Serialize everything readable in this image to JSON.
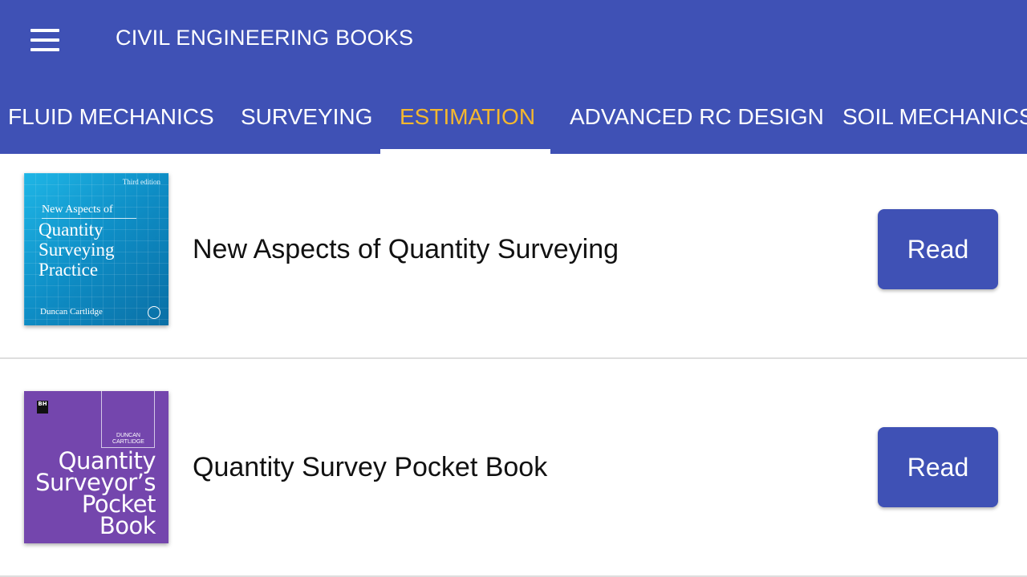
{
  "app_bar": {
    "title": "CIVIL ENGINEERING BOOKS",
    "menu_icon": "hamburger-menu-icon",
    "background_color": "#3f51b5"
  },
  "tabs": [
    {
      "label": "FLUID MECHANICS",
      "active": false
    },
    {
      "label": "SURVEYING",
      "active": false
    },
    {
      "label": "ESTIMATION",
      "active": true
    },
    {
      "label": "ADVANCED RC DESIGN",
      "active": false
    },
    {
      "label": "SOIL MECHANICS",
      "active": false
    }
  ],
  "active_tab_color": "#f5b82e",
  "books": [
    {
      "title": "New Aspects of Quantity Surveying",
      "button_label": "Read",
      "cover": {
        "edition": "Third edition",
        "subtitle": "New Aspects of",
        "title_lines": [
          "Quantity",
          "Surveying",
          "Practice"
        ],
        "author": "Duncan Cartlidge"
      }
    },
    {
      "title": "Quantity Survey Pocket Book",
      "button_label": "Read",
      "cover": {
        "publisher_mark": "BH",
        "author": "DUNCAN CARTLIDGE",
        "title_lines": [
          "Quantity",
          "Surveyor’s",
          "Pocket",
          "Book"
        ]
      }
    }
  ]
}
